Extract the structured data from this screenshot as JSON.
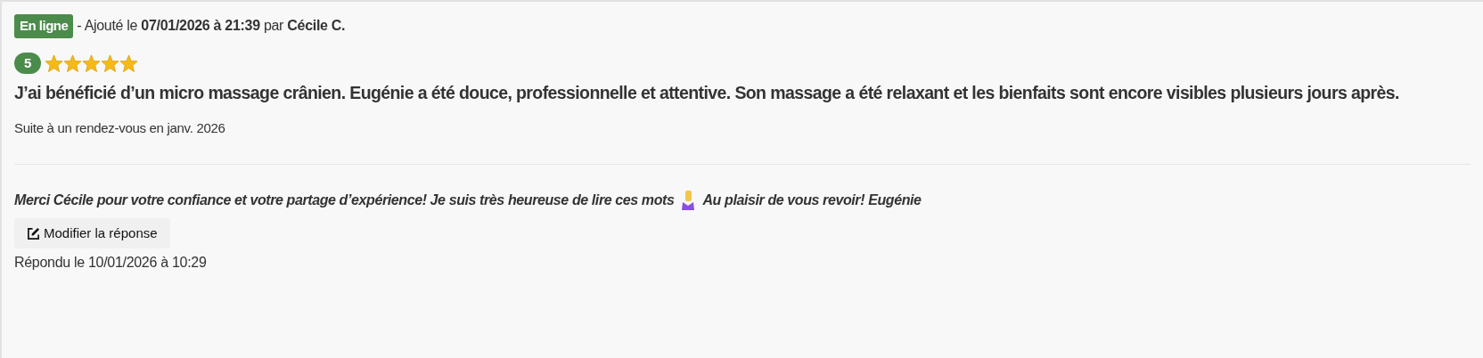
{
  "review": {
    "status": "En ligne",
    "meta_prefix": "- Ajouté le ",
    "date": "07/01/2026 à 21:39",
    "meta_by": "par",
    "author": "Cécile C.",
    "rating": "5",
    "stars": 5,
    "text": "J’ai bénéficié d’un micro massage crânien. Eugénie a été douce, professionnelle et attentive. Son massage a été relaxant et les bienfaits sont encore visibles plusieurs jours après.",
    "context": "Suite à un rendez-vous en janv. 2026"
  },
  "reply": {
    "text_before": "Merci Cécile pour votre confiance et votre partage d’expérience! Je suis très heureuse de lire ces mots",
    "text_after": "Au plaisir de vous revoir! Eugénie",
    "edit_button": "Modifier la réponse",
    "answered": "Répondu le 10/01/2026 à 10:29"
  }
}
